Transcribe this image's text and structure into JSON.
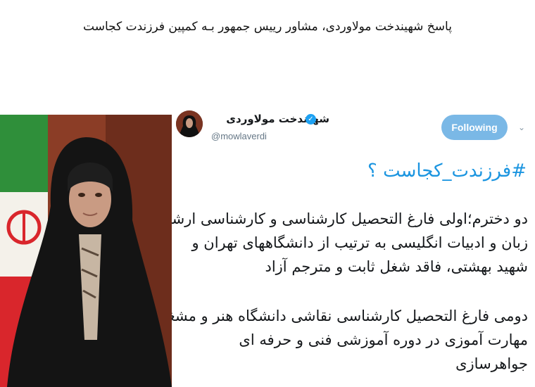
{
  "headline": "پاسخ شهیندخت مولاوردی، مشاور رییس جمهور بـه کمپین فرزندت کجاست",
  "tweet": {
    "user_name": "شهیندخت مولاوردی",
    "verified_symbol": "✓",
    "handle": "@mowlaverdi",
    "follow_label": "Following",
    "caret": "⌄",
    "hashtag": "#فرزندت_کجاست ؟",
    "paragraph1": [
      "دو دخترم؛اولی فارغ التحصیل کارشناسی و کارشناسی ارشد",
      "زبان و ادبیات انگلیسی به ترتیب از دانشگاههای تهران و",
      "شهید بهشتی، فاقد شغل ثابت و مترجم آزاد"
    ],
    "paragraph2": [
      "دومی فارغ التحصیل کارشناسی نقاشی دانشگاه هنر و مشغول",
      "مهارت آموزی در دوره آموزشی فنی و حرفه ای",
      "جواهرسازی"
    ]
  },
  "colors": {
    "follow_button": "#7ab8e6",
    "link": "#1b95e0",
    "verified": "#1da1f2"
  }
}
